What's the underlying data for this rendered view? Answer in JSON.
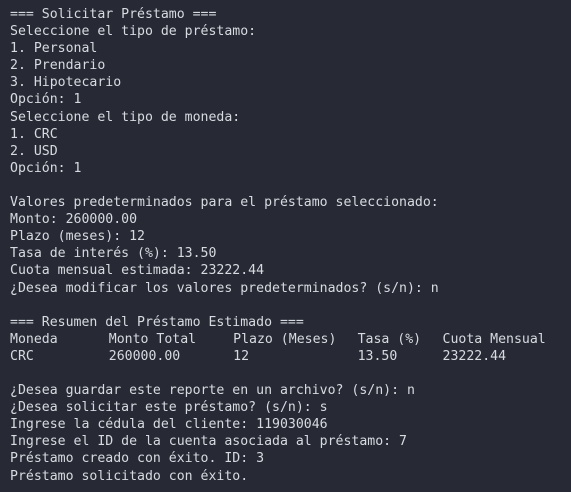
{
  "terminal": {
    "lines_top": [
      "=== Solicitar Préstamo ===",
      "Seleccione el tipo de préstamo:",
      "1. Personal",
      "2. Prendario",
      "3. Hipotecario",
      "Opción: 1",
      "Seleccione el tipo de moneda:",
      "1. CRC",
      "2. USD",
      "Opción: 1"
    ],
    "lines_defaults": [
      "Valores predeterminados para el préstamo seleccionado:",
      "Monto: 260000.00",
      "Plazo (meses): 12",
      "Tasa de interés (%): 13.50",
      "Cuota mensual estimada: 23222.44",
      "¿Desea modificar los valores predeterminados? (s/n): n"
    ],
    "summary_title": "=== Resumen del Préstamo Estimado ===",
    "table": {
      "headers": [
        "Moneda",
        "Monto Total",
        "Plazo (Meses)",
        "Tasa (%)",
        "Cuota Mensual"
      ],
      "row": [
        "CRC",
        "260000.00",
        "12",
        "13.50",
        "23222.44"
      ]
    },
    "lines_bottom": [
      "¿Desea guardar este reporte en un archivo? (s/n): n",
      "¿Desea solicitar este préstamo? (s/n): s",
      "Ingrese la cédula del cliente: 119030046",
      "Ingrese el ID de la cuenta asociada al préstamo: 7",
      "Préstamo creado con éxito. ID: 3",
      "Préstamo solicitado con éxito."
    ]
  }
}
